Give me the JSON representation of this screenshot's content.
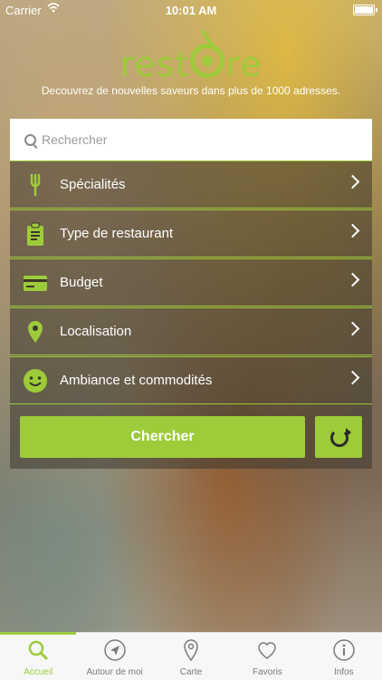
{
  "status_bar": {
    "carrier": "Carrier",
    "time": "10:01 AM"
  },
  "brand": {
    "logo_text": "restore",
    "tagline": "Decouvrez de nouvelles saveurs dans plus de 1000 adresses."
  },
  "search": {
    "placeholder": "Rechercher"
  },
  "filters": [
    {
      "label": "Spécialités",
      "icon": "fork-icon"
    },
    {
      "label": "Type de restaurant",
      "icon": "clipboard-icon"
    },
    {
      "label": "Budget",
      "icon": "credit-card-icon"
    },
    {
      "label": "Localisation",
      "icon": "location-pin-icon"
    },
    {
      "label": "Ambiance et commodités",
      "icon": "smiley-icon"
    }
  ],
  "actions": {
    "search_label": "Chercher"
  },
  "tabs": [
    {
      "label": "Accueil",
      "icon": "search-icon",
      "active": true
    },
    {
      "label": "Autour de moi",
      "icon": "navigation-arrow-icon",
      "active": false
    },
    {
      "label": "Carte",
      "icon": "map-pin-icon",
      "active": false
    },
    {
      "label": "Favoris",
      "icon": "heart-icon",
      "active": false
    },
    {
      "label": "Infos",
      "icon": "info-icon",
      "active": false
    }
  ],
  "colors": {
    "accent": "#9ecb3a",
    "panel": "#3c372d",
    "tab_inactive": "#7a7a7a"
  }
}
